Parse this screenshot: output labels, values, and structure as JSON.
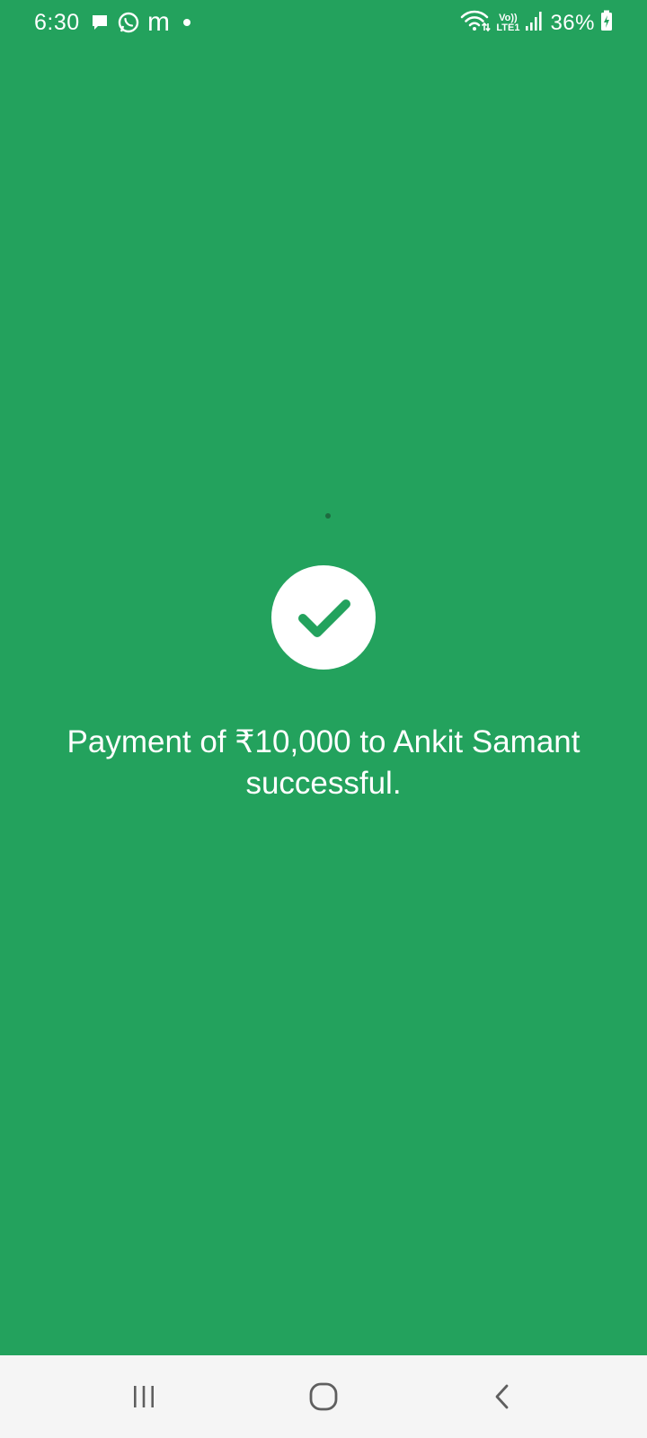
{
  "status_bar": {
    "time": "6:30",
    "notification_icons": [
      "message-icon",
      "whatsapp-icon",
      "m-app-icon",
      "dot-icon"
    ],
    "m_app_glyph": "m",
    "network": {
      "volte_top": "Vo))",
      "volte_bottom": "LTE1"
    },
    "battery_percent": "36%"
  },
  "payment": {
    "message": "Payment of ₹10,000 to Ankit Samant successful.",
    "status_icon": "checkmark-icon",
    "accent_color": "#23a25d"
  },
  "navigation": {
    "buttons": [
      "recents-icon",
      "home-icon",
      "back-icon"
    ]
  }
}
